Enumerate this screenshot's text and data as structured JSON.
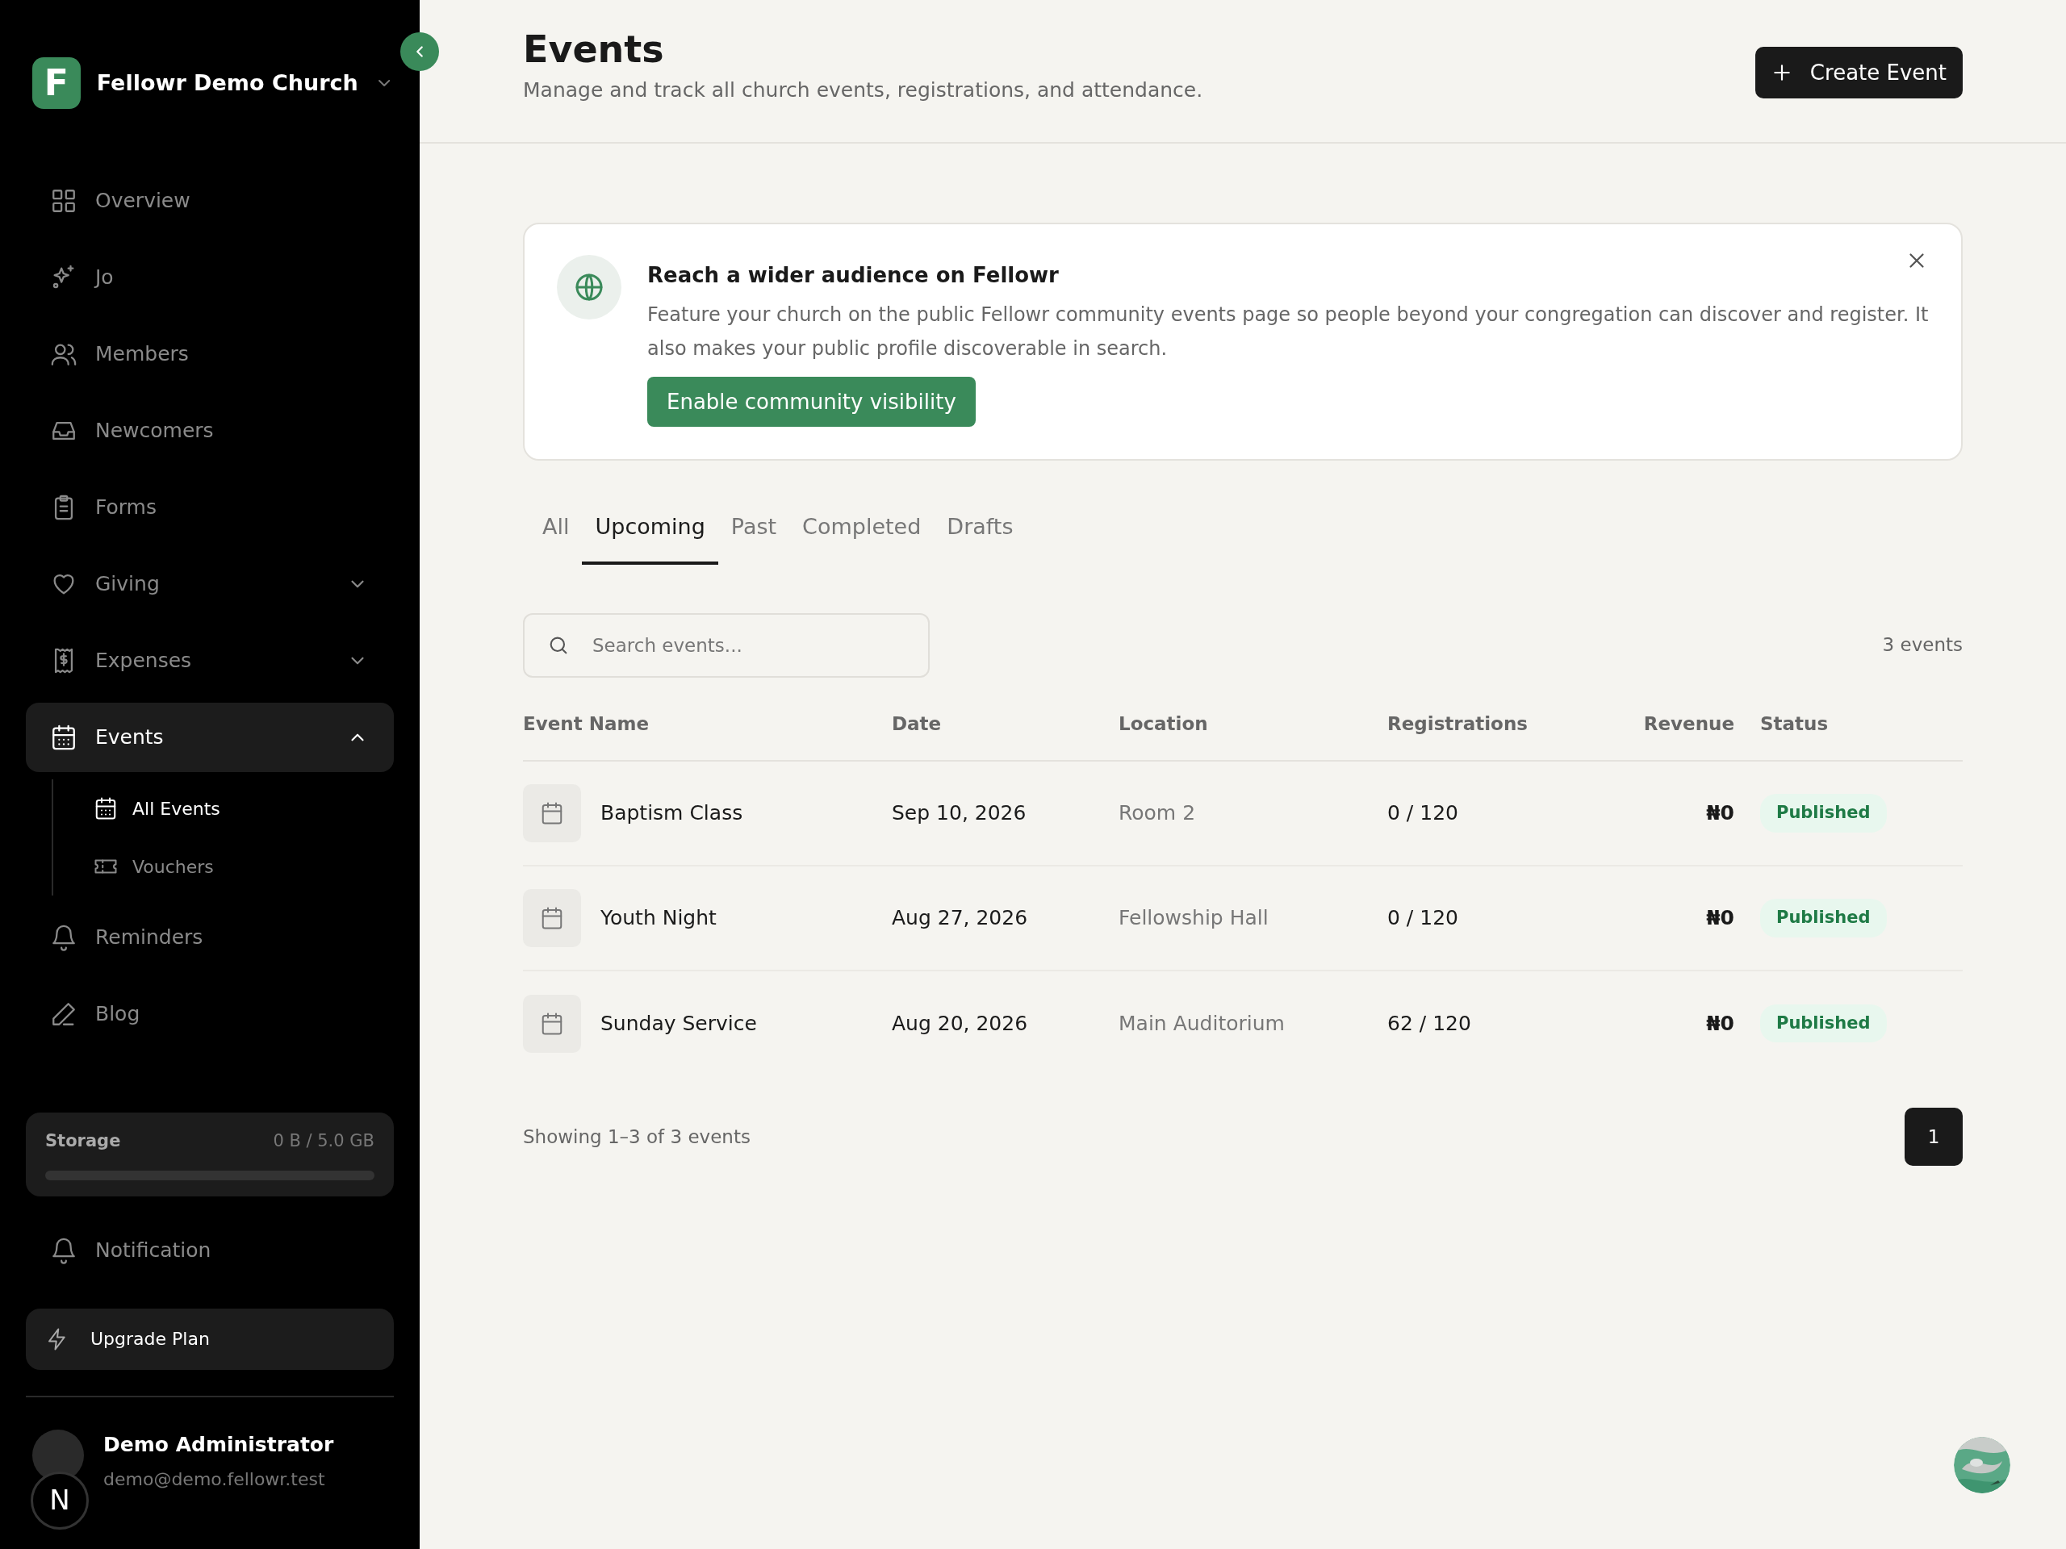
{
  "sidebar": {
    "brand": {
      "logo_letter": "F",
      "name": "Fellowr Demo Church"
    },
    "nav": [
      {
        "label": "Overview",
        "selected": false
      },
      {
        "label": "Jo",
        "selected": false
      },
      {
        "label": "Members",
        "selected": false
      },
      {
        "label": "Newcomers",
        "selected": false
      },
      {
        "label": "Forms",
        "selected": false
      },
      {
        "label": "Giving",
        "selected": false,
        "expanded": false
      },
      {
        "label": "Expenses",
        "selected": false,
        "expanded": false
      },
      {
        "label": "Events",
        "selected": true,
        "expanded": true,
        "children": [
          {
            "label": "All Events",
            "selected": true
          },
          {
            "label": "Vouchers",
            "selected": false
          }
        ]
      },
      {
        "label": "Reminders",
        "selected": false
      },
      {
        "label": "Blog",
        "selected": false
      }
    ],
    "storage": {
      "label": "Storage",
      "reading": "0 B / 5.0 GB",
      "level": 0
    },
    "notification": "Notification",
    "upgrade": "Upgrade Plan",
    "user": {
      "name": "Demo Administrator",
      "email": "demo@demo.fellowr.test"
    },
    "dev_indicator": "N"
  },
  "header": {
    "title": "Events",
    "subtitle": "Manage and track all church events, registrations, and attendance.",
    "button": "Create Event"
  },
  "banner": {
    "title": "Reach a wider audience on Fellowr",
    "text": "Feature your church on the public Fellowr community events page so people beyond your congregation can discover and register. It also makes your public profile discoverable in search.",
    "button": "Enable community visibility"
  },
  "tabs": [
    {
      "label": "All",
      "selected": false
    },
    {
      "label": "Upcoming",
      "selected": true
    },
    {
      "label": "Past",
      "selected": false
    },
    {
      "label": "Completed",
      "selected": false
    },
    {
      "label": "Drafts",
      "selected": false
    }
  ],
  "search": {
    "placeholder": "Search events..."
  },
  "count": "3 events",
  "table": {
    "columns": [
      "Event Name",
      "Date",
      "Location",
      "Registrations",
      "Revenue",
      "Status"
    ],
    "rows": [
      [
        "Baptism Class",
        "Sep 10, 2026",
        "Room 2",
        "0 / 120",
        "₦0",
        "Published"
      ],
      [
        "Youth Night",
        "Aug 27, 2026",
        "Fellowship Hall",
        "0 / 120",
        "₦0",
        "Published"
      ],
      [
        "Sunday Service",
        "Aug 20, 2026",
        "Main Auditorium",
        "62 / 120",
        "₦0",
        "Published"
      ]
    ]
  },
  "footer": {
    "showing": "Showing 1–3 of 3 events",
    "pages": [
      {
        "label": "1",
        "selected": true
      }
    ]
  }
}
